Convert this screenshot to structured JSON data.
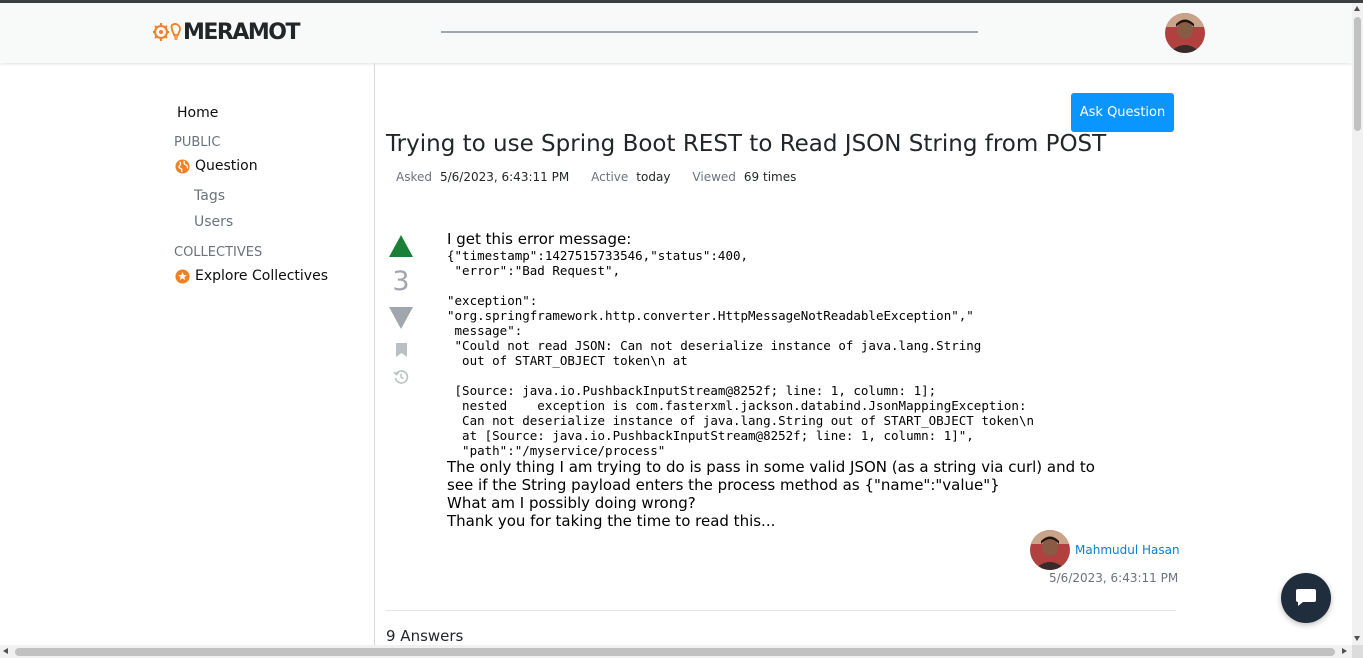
{
  "header": {
    "logo_text": "MERAMOT",
    "avatar_icon": "user-avatar"
  },
  "sidebar": {
    "home": "Home",
    "public_section": "PUBLIC",
    "question": "Question",
    "tags": "Tags",
    "users": "Users",
    "collectives_section": "COLLECTIVES",
    "explore_collectives": "Explore Collectives"
  },
  "question": {
    "ask_button": "Ask Question",
    "title": "Trying to use Spring Boot REST to Read JSON String from POST",
    "asked_label": "Asked",
    "asked_value": "5/6/2023, 6:43:11 PM",
    "active_label": "Active",
    "active_value": "today",
    "viewed_label": "Viewed",
    "viewed_value": "69 times",
    "vote_count": "3",
    "body_intro": "I get this error message:",
    "body_code": "{\"timestamp\":1427515733546,\"status\":400,\n \"error\":\"Bad Request\",\n\n\"exception\":\n\"org.springframework.http.converter.HttpMessageNotReadableException\",\"\n message\":\n \"Could not read JSON: Can not deserialize instance of java.lang.String\n  out of START_OBJECT token\\n at\n\n [Source: java.io.PushbackInputStream@8252f; line: 1, column: 1];\n  nested    exception is com.fasterxml.jackson.databind.JsonMappingException:\n  Can not deserialize instance of java.lang.String out of START_OBJECT token\\n\n  at [Source: java.io.PushbackInputStream@8252f; line: 1, column: 1]\",\n  \"path\":\"/myservice/process\"",
    "body_line1": "The only thing I am trying to do is pass in some valid JSON (as a string via curl) and to see if the String payload enters the process method as {\"name\":\"value\"}",
    "body_line2": "What am I possibly doing wrong?",
    "body_line3": "Thank you for taking the time to read this...",
    "author_name": "Mahmudul Hasan",
    "post_date": "5/6/2023, 6:43:11 PM",
    "answers_count": "9 Answers"
  },
  "colors": {
    "accent": "#0a95ff",
    "upvote": "#1a7f37",
    "logo_orange": "#f48024",
    "chat_button": "#1f2d3d"
  }
}
